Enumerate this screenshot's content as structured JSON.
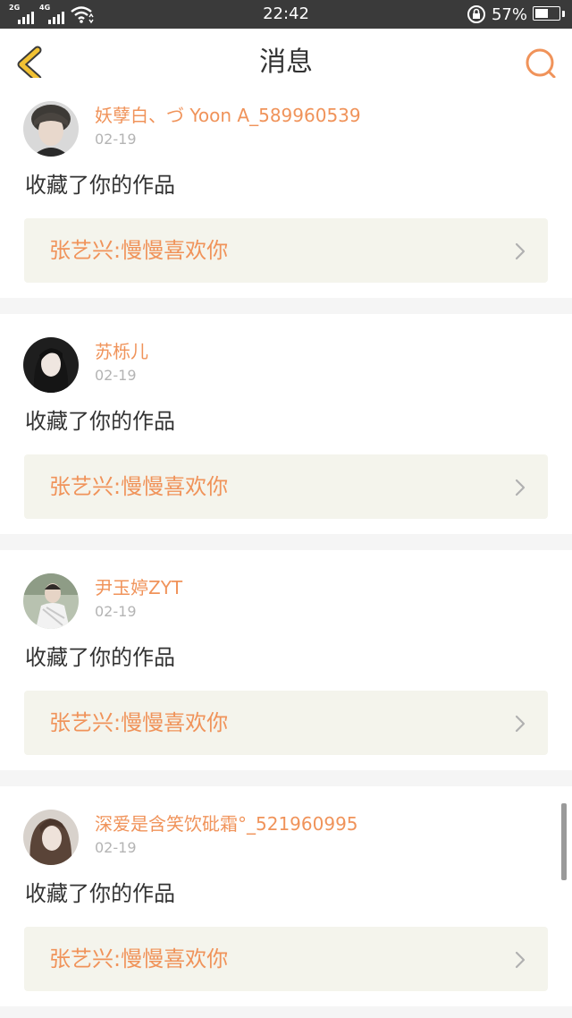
{
  "status_bar": {
    "network1": "2G",
    "network2": "4G",
    "time": "22:42",
    "battery_percent": "57%",
    "battery_level": 0.57
  },
  "header": {
    "title": "消息",
    "back_icon": "chevron-left-icon",
    "search_icon": "search-icon"
  },
  "colors": {
    "accent": "#f0935a",
    "back_icon": "#f2c233",
    "work_bg": "#f4f4ec"
  },
  "messages": [
    {
      "name": "妖孽白、づ Yoon A_589960539",
      "date": "02-19",
      "action": "收藏了你的作品",
      "work": "张艺兴:慢慢喜欢你"
    },
    {
      "name": "苏栎儿",
      "date": "02-19",
      "action": "收藏了你的作品",
      "work": "张艺兴:慢慢喜欢你"
    },
    {
      "name": "尹玉婷ZYT",
      "date": "02-19",
      "action": "收藏了你的作品",
      "work": "张艺兴:慢慢喜欢你"
    },
    {
      "name": "深爱是含笑饮砒霜°_521960995",
      "date": "02-19",
      "action": "收藏了你的作品",
      "work": "张艺兴:慢慢喜欢你"
    }
  ]
}
